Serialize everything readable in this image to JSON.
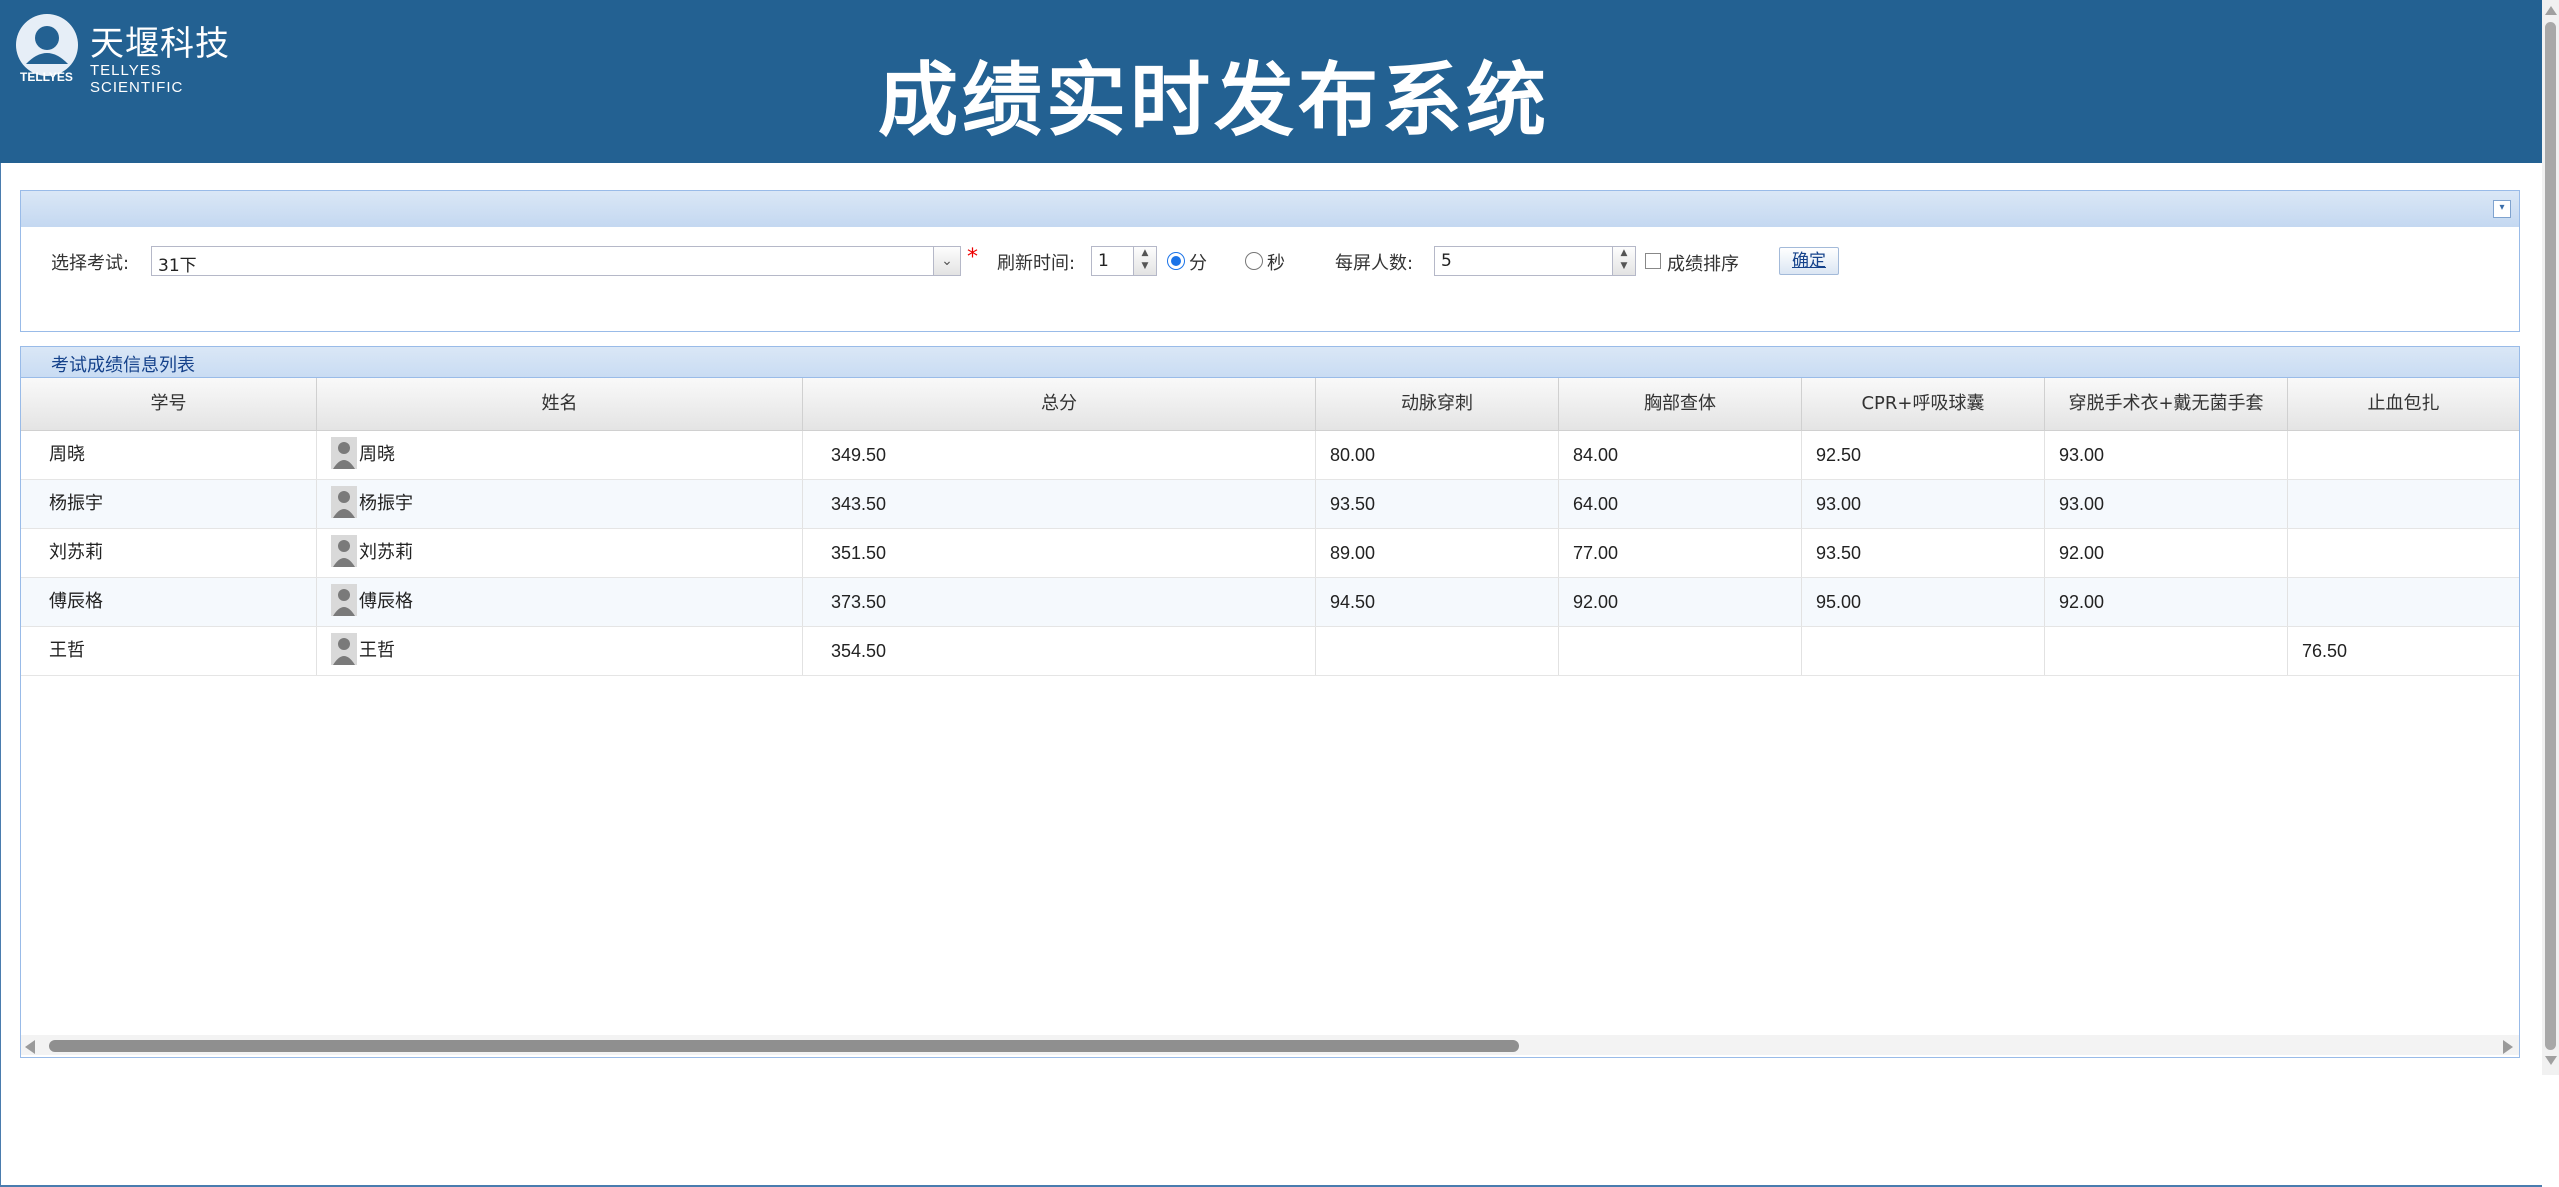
{
  "header": {
    "logo_cn": "天堰科技",
    "logo_en": "TELLYES SCIENTIFIC",
    "logo_mark_text": "TELLYES",
    "title": "成绩实时发布系统",
    "background": "#236192"
  },
  "filter": {
    "exam_label": "选择考试:",
    "exam_value": "31下",
    "required_mark": "*",
    "refresh_label": "刷新时间:",
    "refresh_value": "1",
    "unit_minute": "分",
    "unit_second": "秒",
    "unit_selected": "分",
    "per_screen_label": "每屏人数:",
    "per_screen_value": "5",
    "sort_label": "成绩排序",
    "sort_checked": false,
    "confirm_label": "确定"
  },
  "grid": {
    "title": "考试成绩信息列表",
    "columns": [
      "学号",
      "姓名",
      "总分",
      "动脉穿刺",
      "胸部查体",
      "CPR+呼吸球囊",
      "穿脱手术衣+戴无菌手套",
      "止血包扎"
    ],
    "rows": [
      {
        "id": "周晓",
        "name": "周晓",
        "total": "349.50",
        "c1": "80.00",
        "c2": "84.00",
        "c3": "92.50",
        "c4": "93.00",
        "c5": ""
      },
      {
        "id": "杨振宇",
        "name": "杨振宇",
        "total": "343.50",
        "c1": "93.50",
        "c2": "64.00",
        "c3": "93.00",
        "c4": "93.00",
        "c5": ""
      },
      {
        "id": "刘苏莉",
        "name": "刘苏莉",
        "total": "351.50",
        "c1": "89.00",
        "c2": "77.00",
        "c3": "93.50",
        "c4": "92.00",
        "c5": ""
      },
      {
        "id": "傅辰格",
        "name": "傅辰格",
        "total": "373.50",
        "c1": "94.50",
        "c2": "92.00",
        "c3": "95.00",
        "c4": "92.00",
        "c5": ""
      },
      {
        "id": "王哲",
        "name": "王哲",
        "total": "354.50",
        "c1": "",
        "c2": "",
        "c3": "",
        "c4": "",
        "c5": "76.50"
      }
    ]
  }
}
